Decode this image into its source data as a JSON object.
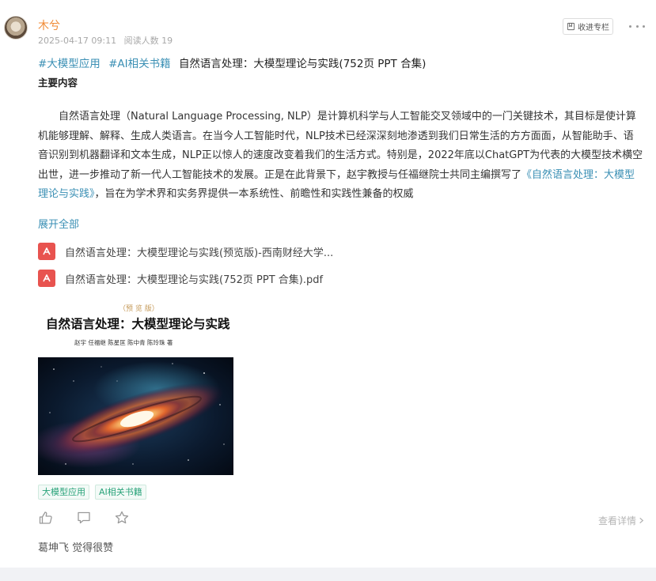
{
  "post": {
    "author": "木兮",
    "date": "2025-04-17 09:11",
    "read_label": "阅读人数 19",
    "collect_label": "收进专栏",
    "tags": [
      "#大模型应用",
      "#AI相关书籍"
    ],
    "title": "自然语言处理：大模型理论与实践(752页 PPT 合集)",
    "section_heading": "主要内容",
    "body_before_link": "自然语言处理（Natural Language Processing, NLP）是计算机科学与人工智能交叉领域中的一门关键技术，其目标是使计算机能够理解、解释、生成人类语言。在当今人工智能时代，NLP技术已经深深刻地渗透到我们日常生活的方方面面，从智能助手、语音识别到机器翻译和文本生成，NLP正以惊人的速度改变着我们的生活方式。特别是，2022年底以ChatGPT为代表的大模型技术横空出世，进一步推动了新一代人工智能技术的发展。正是在此背景下，赵宇教授与任福继院士共同主编撰写了",
    "body_link": "《自然语言处理：大模型理论与实践》",
    "body_after_link": "，旨在为学术界和实务界提供一本系统性、前瞻性和实践性兼备的权威",
    "expand_label": "展开全部",
    "files": [
      "自然语言处理：大模型理论与实践(预览版)-西南财经大学...",
      "自然语言处理：大模型理论与实践(752页 PPT 合集).pdf"
    ],
    "cover": {
      "edition": "（预 览 版）",
      "title": "自然语言处理：大模型理论与实践",
      "authors": "赵宇  任福继  陈星匡  陈中青  陈玲珠  著"
    },
    "chips": [
      "大模型应用",
      "AI相关书籍"
    ],
    "details_label": "查看详情",
    "liker": "葛坤飞 觉得很赞"
  },
  "icons": {
    "collect": "bookmark-icon",
    "more": "more-dots-icon",
    "file": "pdf-file-icon",
    "like": "thumbs-up-icon",
    "comment": "comment-icon",
    "favorite": "star-icon",
    "details": "chevron-right-icon"
  },
  "colors": {
    "author": "#f08a34",
    "link": "#3a8fb4",
    "chip": "#2aa37a",
    "pdf": "#e8534f"
  }
}
